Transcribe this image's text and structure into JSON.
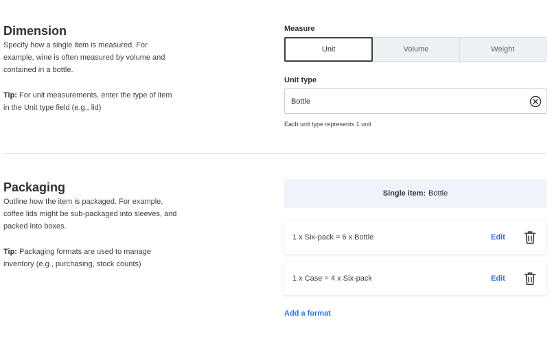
{
  "dimension": {
    "title": "Dimension",
    "description": "Specify how a single item is measured. For example, wine is often measured by volume and contained in a bottle.",
    "tip_label": "Tip:",
    "tip_text": " For unit measurements, enter the type of item in the Unit type field (e.g., lid)",
    "measure_label": "Measure",
    "measure_options": [
      "Unit",
      "Volume",
      "Weight"
    ],
    "measure_selected": "Unit",
    "unit_type_label": "Unit type",
    "unit_type_value": "Bottle",
    "unit_type_hint": "Each unit type represents 1 unit"
  },
  "packaging": {
    "title": "Packaging",
    "description": "Outline how the item is packaged. For example, coffee lids might be sub-packaged into sleeves, and packed into boxes.",
    "tip_label": "Tip:",
    "tip_text": " Packaging formats are used to manage inventory (e.g., purchasing, stock counts)",
    "single_item_label": "Single item:",
    "single_item_value": "Bottle",
    "formats": [
      {
        "text": "1 x Six-pack = 6 x Bottle",
        "edit_label": "Edit"
      },
      {
        "text": "1 x Case = 4 x Six-pack",
        "edit_label": "Edit"
      }
    ],
    "add_format_label": "Add a format"
  },
  "icons": {
    "clear": "clear-circle-x-icon",
    "delete": "trash-icon"
  },
  "colors": {
    "accent_link": "#2f6fdc",
    "single_item_bg": "#f0f4fa"
  }
}
